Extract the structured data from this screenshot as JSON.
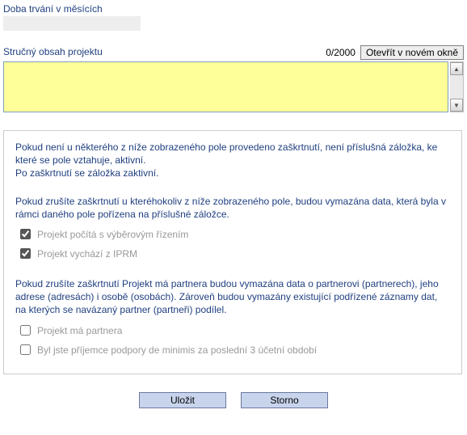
{
  "duration": {
    "label": "Doba trvání v měsících",
    "value": ""
  },
  "summary": {
    "label": "Stručný obsah projektu",
    "counter": "0/2000",
    "open_button": "Otevřít v novém okně",
    "value": ""
  },
  "info": {
    "para1": "Pokud není u některého z níže zobrazeného pole provedeno zaškrtnutí, není příslušná záložka, ke které se pole vztahuje, aktivní.",
    "para1b": "Po zaškrtnutí se záložka zaktivní.",
    "para2": "Pokud zrušíte zaškrtnutí u kteréhokoliv z níže zobrazeného pole, budou vymazána data, která byla v rámci daného pole pořízena na příslušné záložce.",
    "para3": "Pokud zrušíte zaškrtnutí Projekt má partnera budou vymazána data o partnerovi (partnerech), jeho adrese (adresách) i osobě (osobách). Zároveň budou vymazány existující podřízené záznamy dat, na kterých se navázaný partner (partneři) podílel."
  },
  "checkboxes": {
    "cb1": {
      "label": "Projekt počítá s výběrovým řízením",
      "checked": true
    },
    "cb2": {
      "label": "Projekt vychází z IPRM",
      "checked": true
    },
    "cb3": {
      "label": "Projekt má partnera",
      "checked": false
    },
    "cb4": {
      "label": "Byl jste příjemce podpory de minimis za poslední 3 účetní období",
      "checked": false
    }
  },
  "buttons": {
    "save": "Uložit",
    "cancel": "Storno"
  }
}
